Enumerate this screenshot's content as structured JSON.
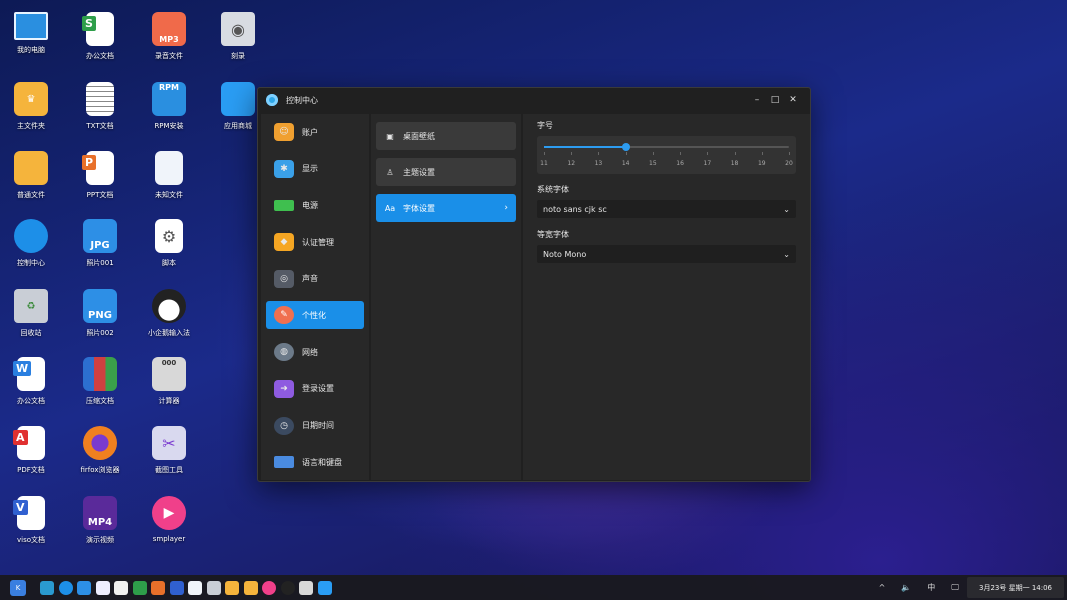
{
  "desktop": {
    "icons": [
      {
        "label": "我的电脑"
      },
      {
        "label": "办公文档"
      },
      {
        "label": "录音文件"
      },
      {
        "label": "刻录"
      },
      {
        "label": "主文件夹"
      },
      {
        "label": "TXT文档"
      },
      {
        "label": "RPM安装"
      },
      {
        "label": "应用商城"
      },
      {
        "label": "普通文件"
      },
      {
        "label": "PPT文档"
      },
      {
        "label": "未知文件"
      },
      {
        "label": "控制中心"
      },
      {
        "label": "照片001"
      },
      {
        "label": "脚本"
      },
      {
        "label": "回收站"
      },
      {
        "label": "照片002"
      },
      {
        "label": "小企鹅输入法"
      },
      {
        "label": "办公文档"
      },
      {
        "label": "压缩文档"
      },
      {
        "label": "计算器"
      },
      {
        "label": "PDF文档"
      },
      {
        "label": "firfox浏览器"
      },
      {
        "label": "截图工具"
      },
      {
        "label": "viso文档"
      },
      {
        "label": "演示视频"
      },
      {
        "label": "smplayer"
      }
    ],
    "badges": {
      "mp3": "MP3",
      "rpm": "RPM",
      "jpg": "JPG",
      "png": "PNG",
      "mp4": "MP4",
      "calc": "000",
      "word": "W",
      "ppt": "P",
      "pdf": "A",
      "viso": "V",
      "sheet": "S"
    }
  },
  "window": {
    "title": "控制中心",
    "controls": {
      "minimize": "–",
      "maximize": "□",
      "close": "✕"
    },
    "nav": [
      {
        "label": "账户",
        "icon": "account-icon",
        "color": "#f0a030"
      },
      {
        "label": "显示",
        "icon": "display-icon",
        "color": "#3aa0e8"
      },
      {
        "label": "电源",
        "icon": "battery-icon",
        "color": "#3fbf4f"
      },
      {
        "label": "认证管理",
        "icon": "auth-icon",
        "color": "#f5a623"
      },
      {
        "label": "声音",
        "icon": "speaker-icon",
        "color": "#555b66"
      },
      {
        "label": "个性化",
        "icon": "palette-icon",
        "color": "#f07050"
      },
      {
        "label": "网络",
        "icon": "globe-icon",
        "color": "#6c7a89"
      },
      {
        "label": "登录设置",
        "icon": "login-icon",
        "color": "#8e5be0"
      },
      {
        "label": "日期时间",
        "icon": "clock-icon",
        "color": "#3b4a60"
      },
      {
        "label": "语言和键盘",
        "icon": "keyboard-icon",
        "color": "#4a8be0"
      }
    ],
    "sub_nav": [
      {
        "label": "桌面壁纸",
        "icon": "wallpaper-icon",
        "glyph": "▣"
      },
      {
        "label": "主题设置",
        "icon": "theme-icon",
        "glyph": "♙"
      },
      {
        "label": "字体设置",
        "icon": "font-icon",
        "glyph": "Aa",
        "chevron": "›"
      }
    ],
    "font_settings": {
      "size_label": "字号",
      "size_value": 14,
      "size_min": 11,
      "size_max": 20,
      "size_ticks": [
        "11",
        "12",
        "13",
        "14",
        "15",
        "16",
        "17",
        "18",
        "19",
        "20"
      ],
      "system_font_label": "系统字体",
      "system_font_value": "noto sans cjk sc",
      "mono_font_label": "等宽字体",
      "mono_font_value": "Noto Mono",
      "dropdown_arrow": "⌄"
    },
    "accent_color": "#1a8fe8"
  },
  "taskbar": {
    "tray": {
      "expand": "^",
      "volume": "🔈",
      "ime": "中",
      "network": "🖵"
    },
    "clock": "3月23号 星期一 14:06"
  }
}
